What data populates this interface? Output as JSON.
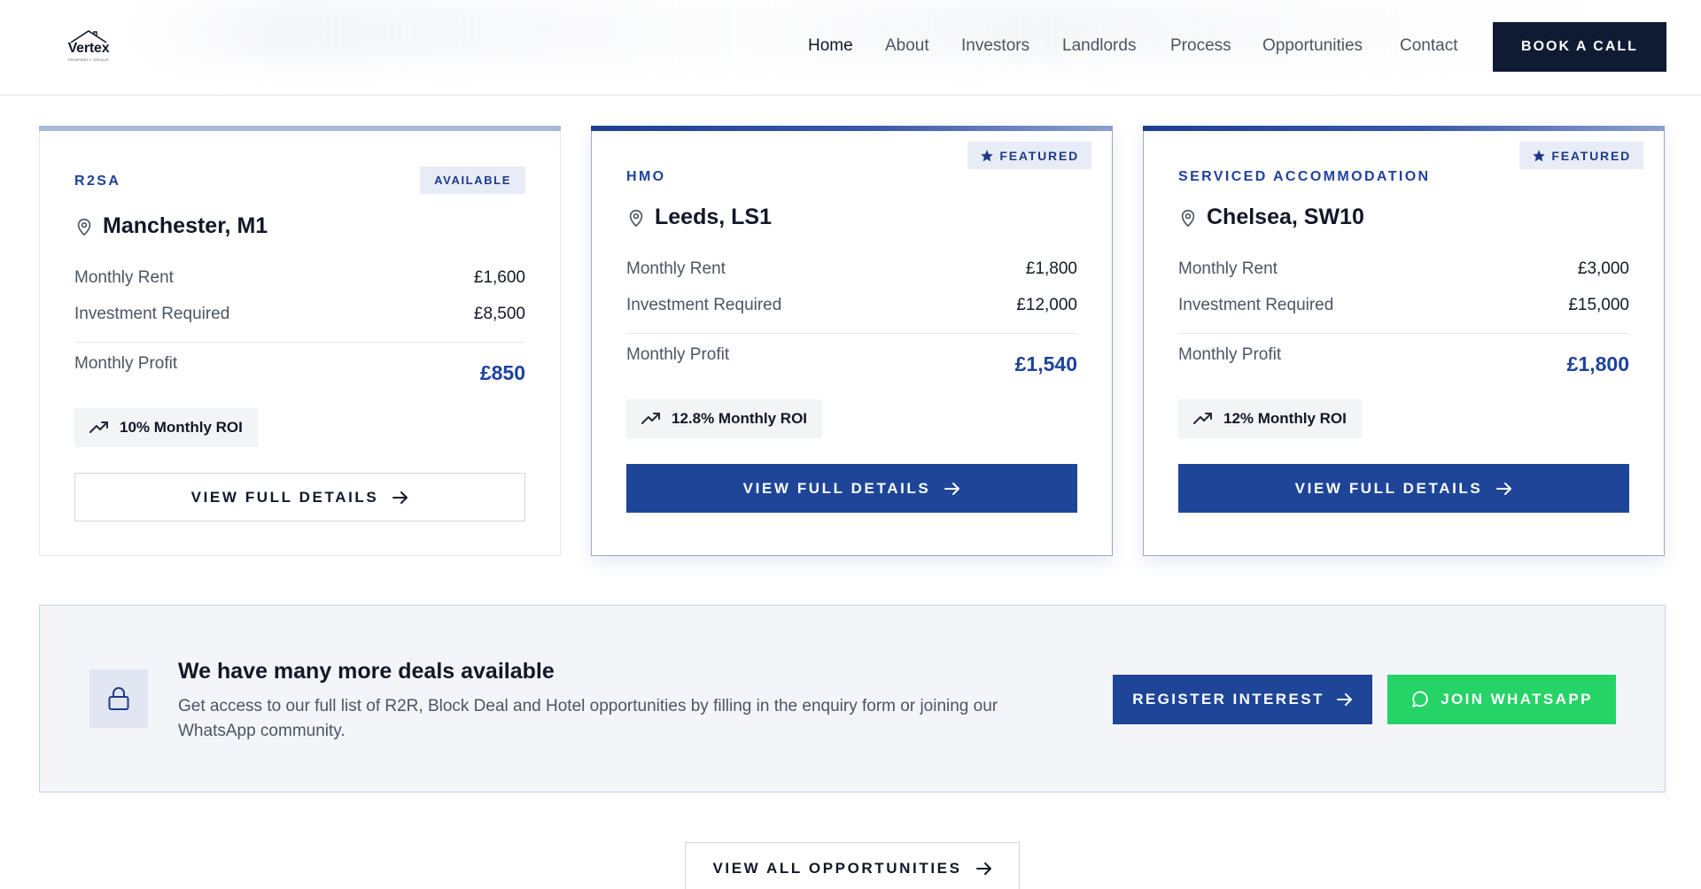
{
  "header": {
    "logo_text": "Vertex",
    "logo_subtext": "PROPERTY GROUP",
    "nav": [
      {
        "label": "Home",
        "active": true
      },
      {
        "label": "About",
        "active": false
      },
      {
        "label": "Investors",
        "active": false
      },
      {
        "label": "Landlords",
        "active": false
      },
      {
        "label": "Process",
        "active": false
      },
      {
        "label": "Opportunities",
        "active": false
      },
      {
        "label": "Contact",
        "active": false
      }
    ],
    "cta_label": "BOOK A CALL"
  },
  "cards": [
    {
      "type": "R2SA",
      "badge": "AVAILABLE",
      "featured": false,
      "location": "Manchester, M1",
      "rent_label": "Monthly Rent",
      "rent": "£1,600",
      "investment_label": "Investment Required",
      "investment": "£8,500",
      "profit_label": "Monthly Profit",
      "profit": "£850",
      "roi": "10% Monthly ROI",
      "button": "VIEW FULL DETAILS"
    },
    {
      "type": "HMO",
      "badge": "FEATURED",
      "featured": true,
      "location": "Leeds, LS1",
      "rent_label": "Monthly Rent",
      "rent": "£1,800",
      "investment_label": "Investment Required",
      "investment": "£12,000",
      "profit_label": "Monthly Profit",
      "profit": "£1,540",
      "roi": "12.8% Monthly ROI",
      "button": "VIEW FULL DETAILS"
    },
    {
      "type": "SERVICED ACCOMMODATION",
      "badge": "FEATURED",
      "featured": true,
      "location": "Chelsea, SW10",
      "rent_label": "Monthly Rent",
      "rent": "£3,000",
      "investment_label": "Investment Required",
      "investment": "£15,000",
      "profit_label": "Monthly Profit",
      "profit": "£1,800",
      "roi": "12% Monthly ROI",
      "button": "VIEW FULL DETAILS"
    }
  ],
  "banner": {
    "title": "We have many more deals available",
    "text": "Get access to our full list of R2R, Block Deal and Hotel opportunities by filling in the enquiry form or joining our WhatsApp community.",
    "register_label": "REGISTER INTEREST",
    "whatsapp_label": "JOIN WHATSAPP"
  },
  "view_all_label": "VIEW ALL OPPORTUNITIES",
  "colors": {
    "primary": "#1e4598",
    "dark": "#0f1b33",
    "whatsapp": "#25d366",
    "accent_text": "#1e429f"
  },
  "icons": {
    "location": "map-pin-icon",
    "trend": "trending-up-icon",
    "arrow": "arrow-right-icon",
    "star": "star-icon",
    "lock": "lock-icon",
    "chat": "message-circle-icon"
  }
}
